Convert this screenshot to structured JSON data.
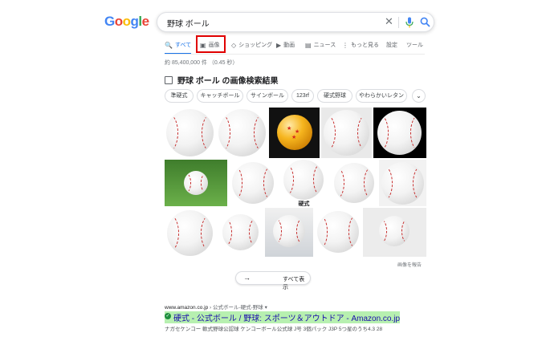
{
  "logo": {
    "letters": [
      "G",
      "o",
      "o",
      "g",
      "l",
      "e"
    ],
    "colors": [
      "#4285f4",
      "#ea4335",
      "#fbbc05",
      "#4285f4",
      "#34a853",
      "#ea4335"
    ]
  },
  "search": {
    "query": "野球 ボール",
    "clear_icon": "close-icon",
    "mic_icon": "mic-icon",
    "search_icon": "search-icon"
  },
  "tabs": [
    {
      "label": "すべて",
      "icon": "🔍",
      "active": true
    },
    {
      "label": "画像",
      "icon": "▣",
      "active": false
    },
    {
      "label": "ショッピング",
      "icon": "◇",
      "active": false
    },
    {
      "label": "動画",
      "icon": "▶",
      "active": false
    },
    {
      "label": "ニュース",
      "icon": "▤",
      "active": false
    },
    {
      "label": "もっと見る",
      "icon": "⋮",
      "active": false
    },
    {
      "label": "設定",
      "icon": "",
      "active": false
    },
    {
      "label": "ツール",
      "icon": "",
      "active": false
    }
  ],
  "result_stats": "約 85,400,000 件 （0.45 秒）",
  "images_heading": "野球 ボール の画像検索結果",
  "chips": [
    "準硬式",
    "キャッチボール",
    "サインボール",
    "123rf",
    "硬式野球",
    "やわらかいレタン"
  ],
  "grid_label": "硬式",
  "report_label": "画像を報告",
  "show_all_label": "すべて表示",
  "result": {
    "cite_domain": "www.amazon.co.jp",
    "cite_path": " › 公式ボール-硬式-野球 ▾",
    "title": "硬式 - 公式ボール / 野球: スポーツ＆アウトドア - Amazon.co.jp",
    "snippet": "ナガセケンコー 軟式野球公認球 ケンコーボール公式球 J号 3個パック J3P 5つ星のうち4.3 28"
  },
  "colors": {
    "accent": "#1a73e8",
    "highlight_box": "#e00000",
    "link": "#1a0dab",
    "title_highlight": "#b7f0b0"
  }
}
